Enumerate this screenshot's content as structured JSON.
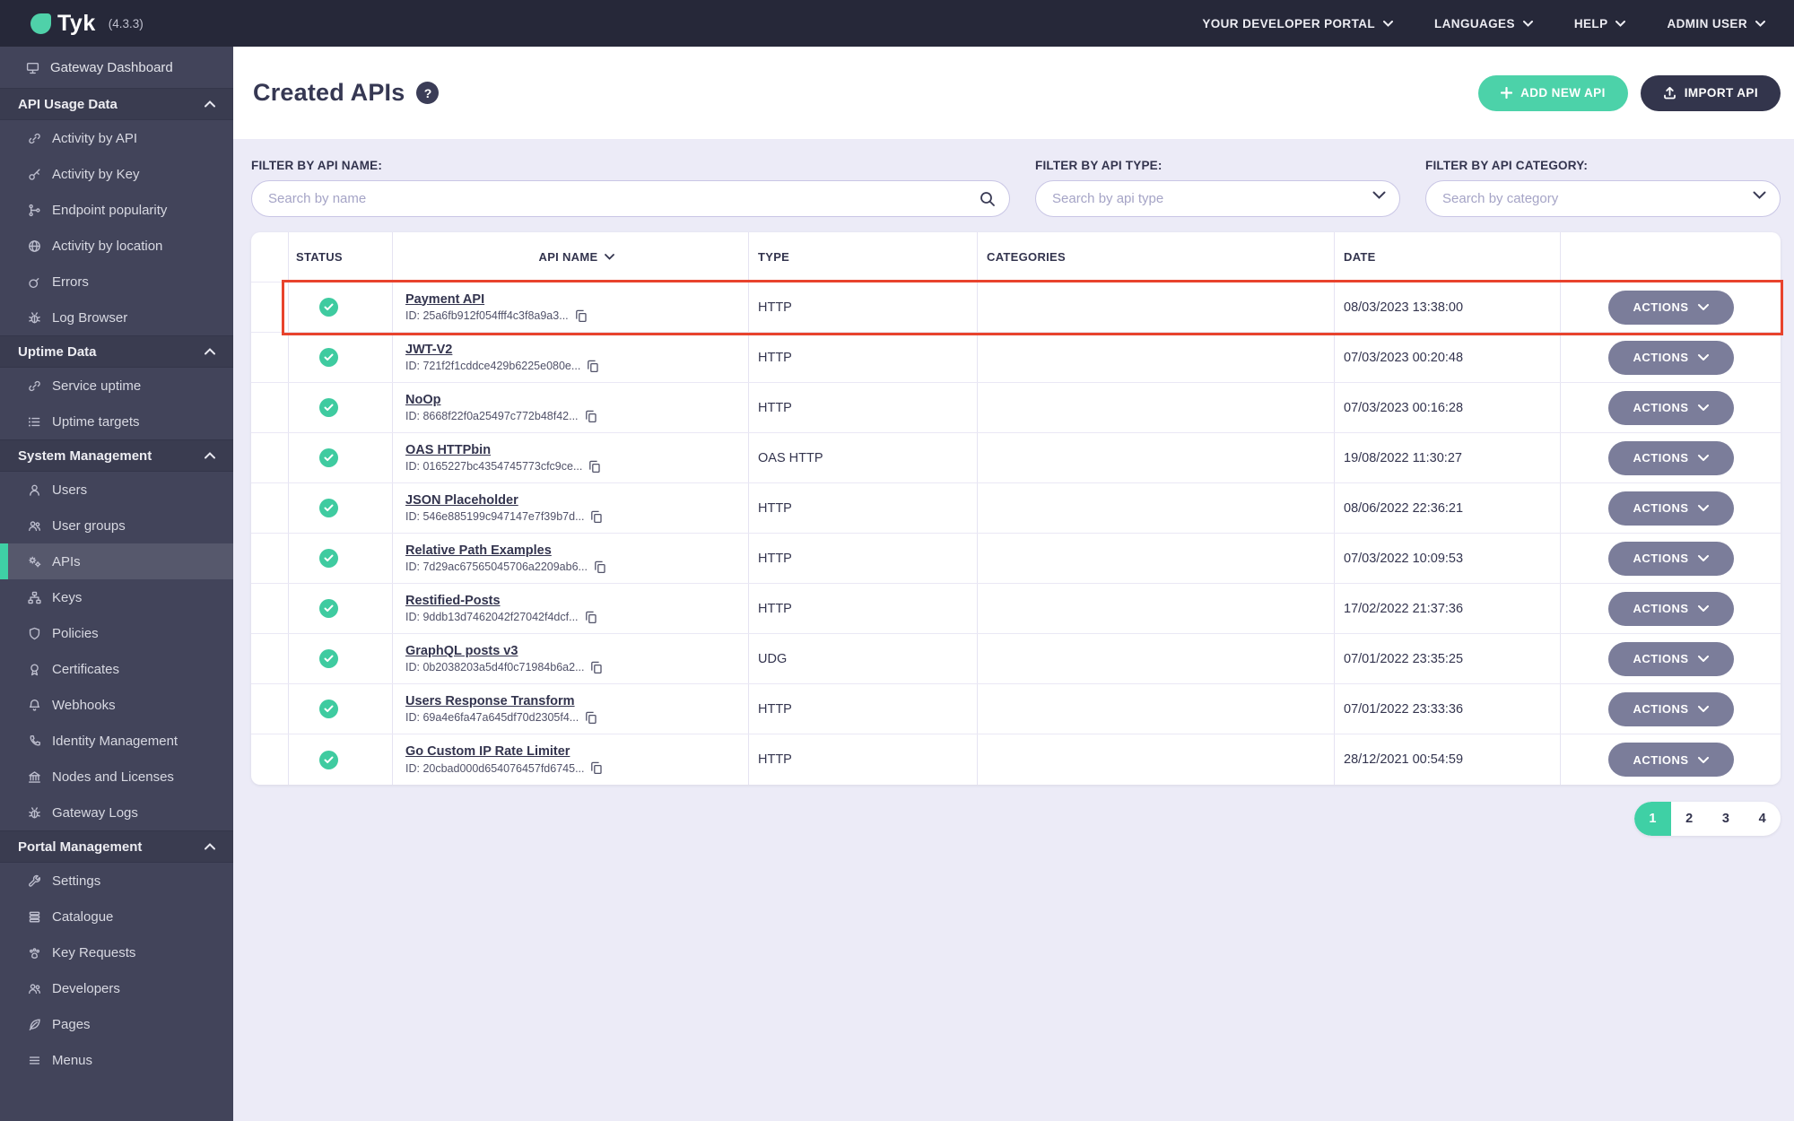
{
  "topbar": {
    "logo_text": "Tyk",
    "version": "(4.3.3)",
    "menu": [
      {
        "label": "YOUR DEVELOPER PORTAL"
      },
      {
        "label": "LANGUAGES"
      },
      {
        "label": "HELP"
      },
      {
        "label": "ADMIN USER"
      }
    ]
  },
  "sidebar": {
    "top_item": {
      "label": "Gateway Dashboard",
      "icon": "monitor-icon"
    },
    "sections": [
      {
        "title": "API Usage Data",
        "items": [
          {
            "label": "Activity by API",
            "icon": "link-icon"
          },
          {
            "label": "Activity by Key",
            "icon": "key-icon"
          },
          {
            "label": "Endpoint popularity",
            "icon": "branch-icon"
          },
          {
            "label": "Activity by location",
            "icon": "globe-icon"
          },
          {
            "label": "Errors",
            "icon": "bomb-icon"
          },
          {
            "label": "Log Browser",
            "icon": "bug-icon"
          }
        ]
      },
      {
        "title": "Uptime Data",
        "items": [
          {
            "label": "Service uptime",
            "icon": "link-icon"
          },
          {
            "label": "Uptime targets",
            "icon": "list-icon"
          }
        ]
      },
      {
        "title": "System Management",
        "items": [
          {
            "label": "Users",
            "icon": "user-icon"
          },
          {
            "label": "User groups",
            "icon": "users-icon"
          },
          {
            "label": "APIs",
            "icon": "gears-icon",
            "active": true
          },
          {
            "label": "Keys",
            "icon": "sitemap-icon"
          },
          {
            "label": "Policies",
            "icon": "shield-icon"
          },
          {
            "label": "Certificates",
            "icon": "certificate-icon"
          },
          {
            "label": "Webhooks",
            "icon": "bell-icon"
          },
          {
            "label": "Identity Management",
            "icon": "phone-icon"
          },
          {
            "label": "Nodes and Licenses",
            "icon": "bank-icon"
          },
          {
            "label": "Gateway Logs",
            "icon": "bug-icon"
          }
        ]
      },
      {
        "title": "Portal Management",
        "items": [
          {
            "label": "Settings",
            "icon": "wrench-icon"
          },
          {
            "label": "Catalogue",
            "icon": "layers-icon"
          },
          {
            "label": "Key Requests",
            "icon": "paw-icon"
          },
          {
            "label": "Developers",
            "icon": "users-icon"
          },
          {
            "label": "Pages",
            "icon": "leaf-icon"
          },
          {
            "label": "Menus",
            "icon": "menu-icon"
          }
        ]
      }
    ]
  },
  "page": {
    "title": "Created APIs",
    "help_glyph": "?",
    "add_button_label": "ADD NEW API",
    "import_button_label": "IMPORT API"
  },
  "filters": {
    "name": {
      "label": "FILTER BY API NAME:",
      "placeholder": "Search by name"
    },
    "type": {
      "label": "FILTER BY API TYPE:",
      "placeholder": "Search by api type"
    },
    "category": {
      "label": "FILTER BY API CATEGORY:",
      "placeholder": "Search by category"
    }
  },
  "table": {
    "columns": [
      "STATUS",
      "API NAME",
      "TYPE",
      "CATEGORIES",
      "DATE"
    ],
    "actions_label": "ACTIONS",
    "rows": [
      {
        "status": "active",
        "name": "Payment API",
        "id": "ID: 25a6fb912f054fff4c3f8a9a3...",
        "type": "HTTP",
        "categories": "",
        "date": "08/03/2023 13:38:00",
        "highlighted": true
      },
      {
        "status": "active",
        "name": "JWT-V2",
        "id": "ID: 721f2f1cddce429b6225e080e...",
        "type": "HTTP",
        "categories": "",
        "date": "07/03/2023 00:20:48"
      },
      {
        "status": "active",
        "name": "NoOp",
        "id": "ID: 8668f22f0a25497c772b48f42...",
        "type": "HTTP",
        "categories": "",
        "date": "07/03/2023 00:16:28"
      },
      {
        "status": "active",
        "name": "OAS HTTPbin",
        "id": "ID: 0165227bc4354745773cfc9ce...",
        "type": "OAS HTTP",
        "categories": "",
        "date": "19/08/2022 11:30:27"
      },
      {
        "status": "active",
        "name": "JSON Placeholder",
        "id": "ID: 546e885199c947147e7f39b7d...",
        "type": "HTTP",
        "categories": "",
        "date": "08/06/2022 22:36:21"
      },
      {
        "status": "active",
        "name": "Relative Path Examples",
        "id": "ID: 7d29ac67565045706a2209ab6...",
        "type": "HTTP",
        "categories": "",
        "date": "07/03/2022 10:09:53"
      },
      {
        "status": "active",
        "name": "Restified-Posts",
        "id": "ID: 9ddb13d7462042f27042f4dcf...",
        "type": "HTTP",
        "categories": "",
        "date": "17/02/2022 21:37:36"
      },
      {
        "status": "active",
        "name": "GraphQL posts v3",
        "id": "ID: 0b2038203a5d4f0c71984b6a2...",
        "type": "UDG",
        "categories": "",
        "date": "07/01/2022 23:35:25"
      },
      {
        "status": "active",
        "name": "Users Response Transform",
        "id": "ID: 69a4e6fa47a645df70d2305f4...",
        "type": "HTTP",
        "categories": "",
        "date": "07/01/2022 23:33:36"
      },
      {
        "status": "active",
        "name": "Go Custom IP Rate Limiter",
        "id": "ID: 20cbad000d654076457fd6745...",
        "type": "HTTP",
        "categories": "",
        "date": "28/12/2021 00:54:59"
      }
    ]
  },
  "pagination": {
    "pages": [
      "1",
      "2",
      "3",
      "4"
    ],
    "active_page": "1"
  },
  "colors": {
    "topbar": "#262839",
    "sidebar": "#42445A",
    "background": "#ECEBF7",
    "accent_teal": "#4CD2A9",
    "active_sidebar_bar": "#3FD0A5",
    "status_green": "#3FCBA0",
    "dark_navy": "#33354C",
    "actions_gray": "#7B7D9A",
    "highlight_red": "#E8432D"
  }
}
